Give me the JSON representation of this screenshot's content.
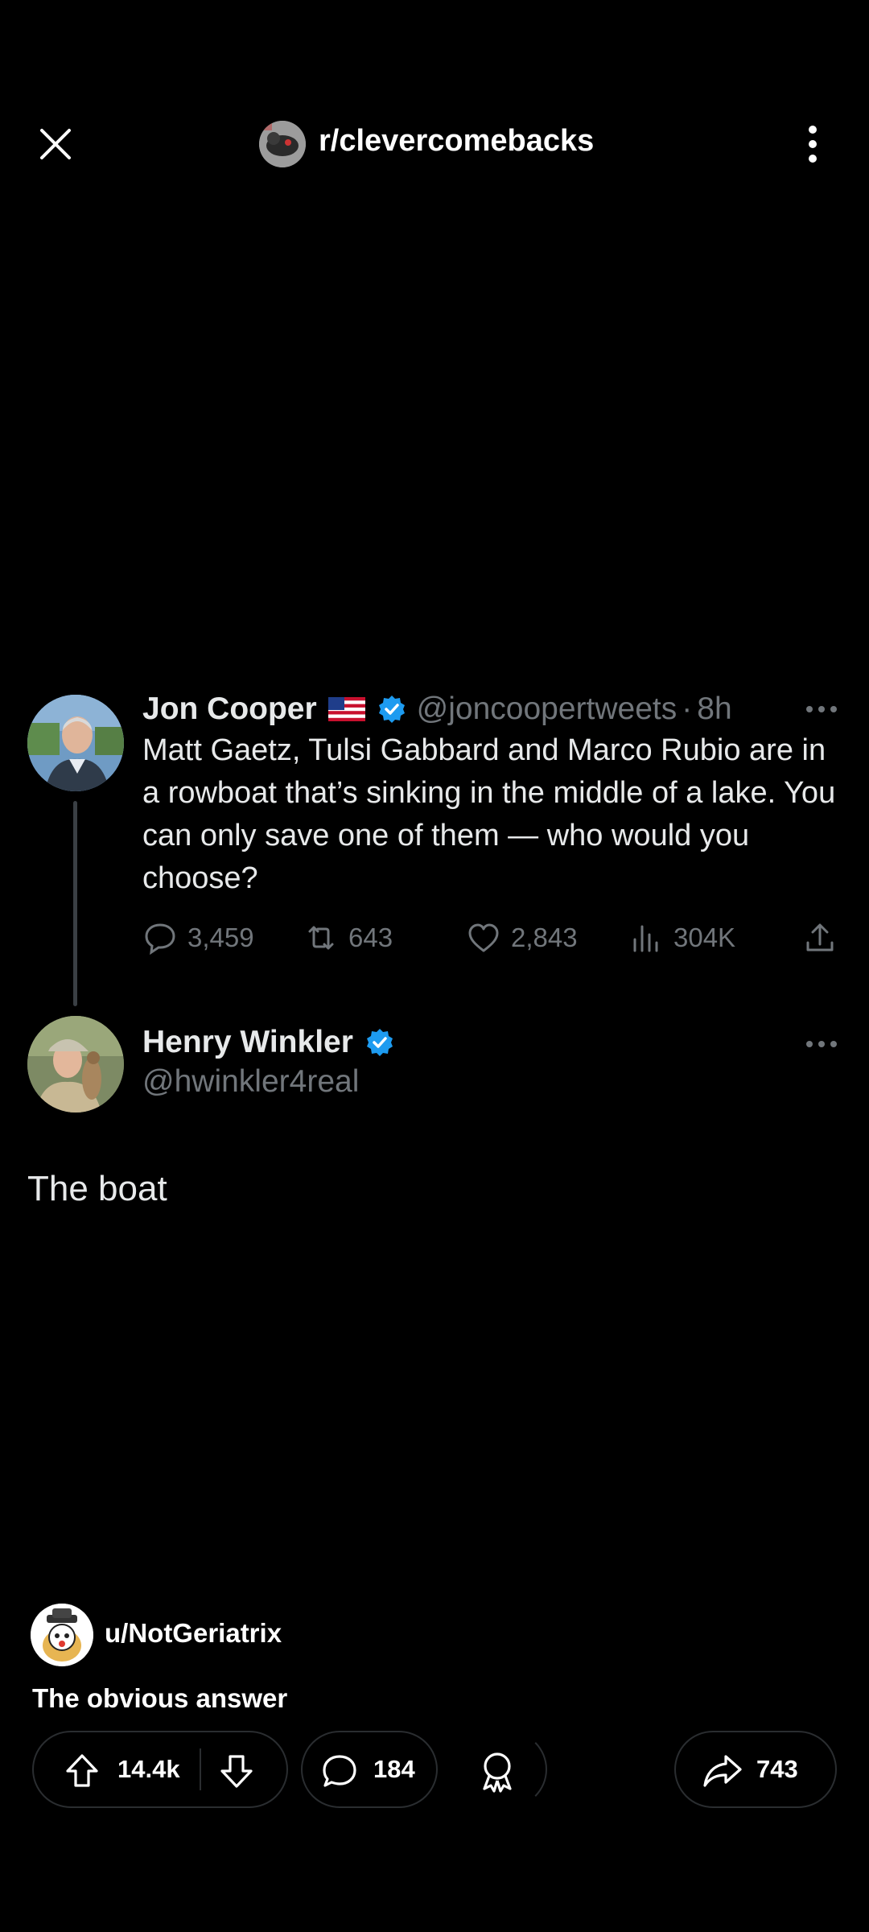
{
  "topbar": {
    "subreddit": "r/clevercomebacks",
    "close_icon": "close-icon",
    "more_icon": "more-vertical-icon"
  },
  "tweet1": {
    "name": "Jon Cooper",
    "handle": "@joncoopertweets",
    "dot": "·",
    "time": "8h",
    "text": "Matt Gaetz, Tulsi Gabbard and Marco Rubio are in a rowboat that’s sinking in the middle of a lake. You can only save one of them — who would you choose?",
    "replies": "3,459",
    "reposts": "643",
    "likes": "2,843",
    "views": "304K"
  },
  "tweet2": {
    "name": "Henry Winkler",
    "handle": "@hwinkler4real",
    "text": "The boat"
  },
  "post": {
    "author": "u/NotGeriatrix",
    "title": "The obvious answer",
    "upvotes": "14.4k",
    "comments": "184",
    "shares": "743"
  },
  "colors": {
    "background": "#000000",
    "verified": "#1d9bf0",
    "muted": "#71767b",
    "text": "#e7e9ea"
  }
}
